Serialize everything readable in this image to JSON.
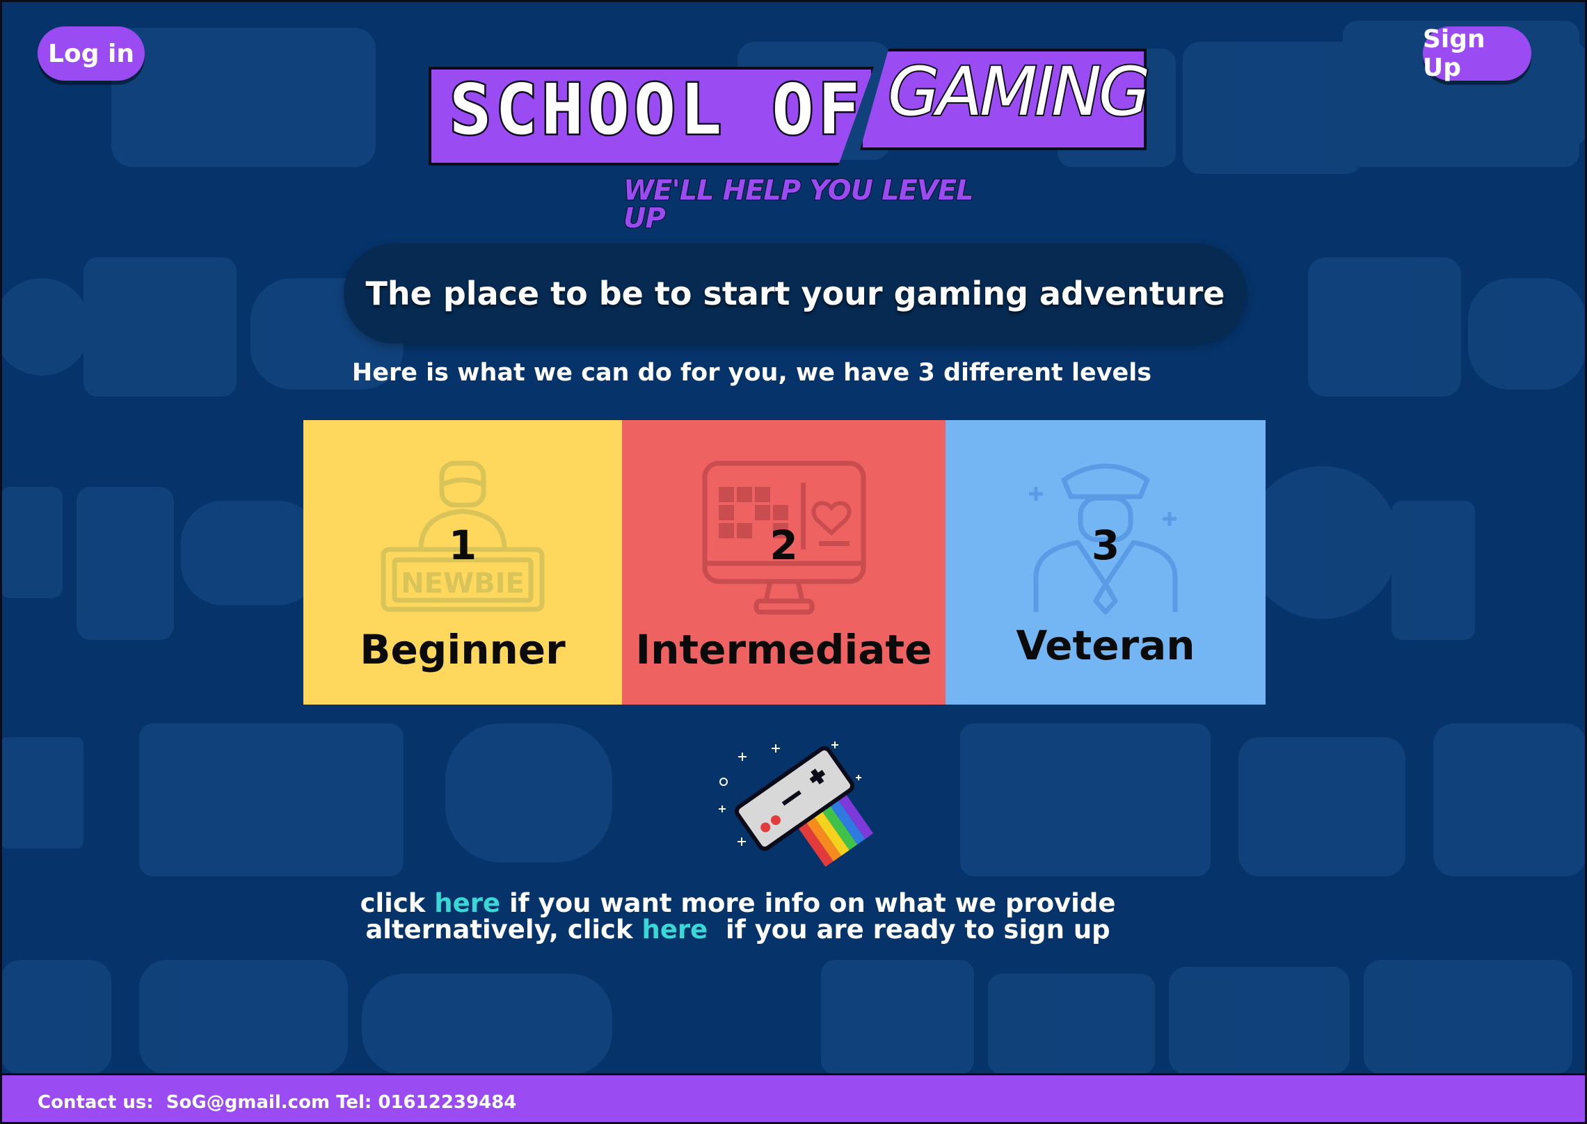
{
  "header": {
    "login_label": "Log in",
    "signup_label": "Sign Up"
  },
  "logo": {
    "part1": "SCHOOL OF",
    "part2": "GAMING",
    "tagline": "WE'LL HELP YOU LEVEL UP"
  },
  "hero": {
    "title": "The place to be to start your gaming adventure",
    "subtitle": "Here is what we can do for you, we have 3 different levels"
  },
  "levels": [
    {
      "number": "1",
      "name": "Beginner",
      "icon": "newbie-icon",
      "badge_text": "NEWBIE",
      "color": "#fed85d"
    },
    {
      "number": "2",
      "name": "Intermediate",
      "icon": "monitor-game-icon",
      "color": "#ee6262"
    },
    {
      "number": "3",
      "name": "Veteran",
      "icon": "veteran-soldier-icon",
      "color": "#74b6f4"
    }
  ],
  "info": {
    "line1_pre": "click ",
    "line1_link": "here",
    "line1_post": " if you want more info on what we provide",
    "line2_pre": "alternatively, click ",
    "line2_link": "here",
    "line2_post": "  if you are ready to sign up"
  },
  "footer": {
    "contact": "Contact us:  SoG@gmail.com Tel: 01612239484"
  },
  "colors": {
    "background": "#05336a",
    "accent": "#9a4cf2",
    "link": "#39d7d6"
  }
}
